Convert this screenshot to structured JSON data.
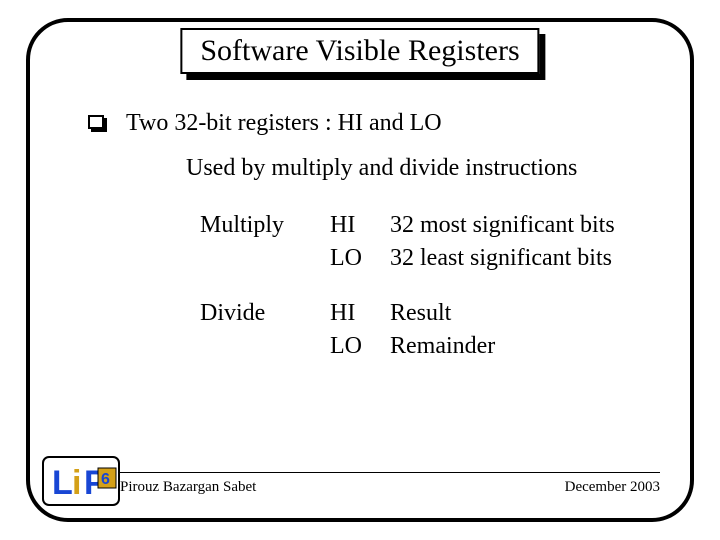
{
  "title": "Software Visible Registers",
  "bullet_line": "Two 32-bit registers : HI and LO",
  "sub_line": "Used by multiply and divide instructions",
  "ops": {
    "multiply": {
      "label": "Multiply",
      "hi": {
        "reg": "HI",
        "desc": "32 most significant bits"
      },
      "lo": {
        "reg": "LO",
        "desc": "32 least significant bits"
      }
    },
    "divide": {
      "label": "Divide",
      "hi": {
        "reg": "HI",
        "desc": "Result"
      },
      "lo": {
        "reg": "LO",
        "desc": "Remainder"
      }
    }
  },
  "footer": {
    "author": "Pirouz Bazargan Sabet",
    "date": "December 2003"
  },
  "logo": {
    "text_l": "L",
    "text_i": "i",
    "text_p": "P",
    "text_6": "6"
  }
}
